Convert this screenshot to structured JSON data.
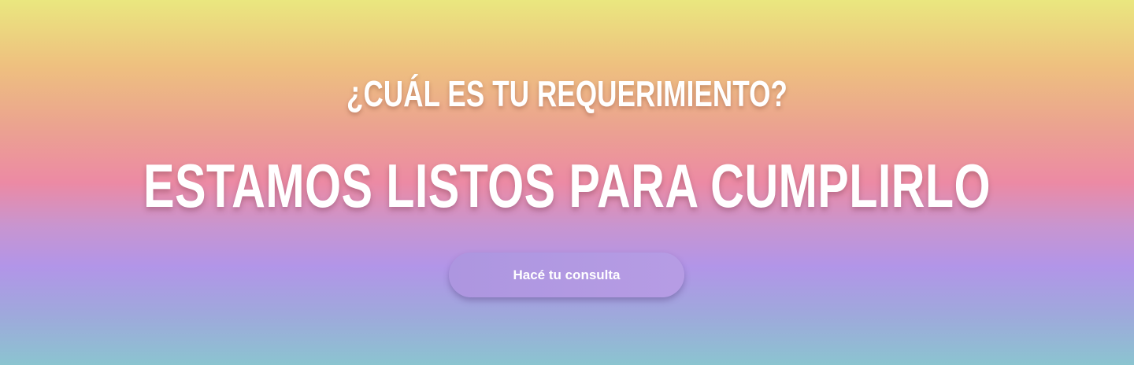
{
  "hero": {
    "kicker": "¿Cuál es tu requerimiento?",
    "headline": "Estamos listos para cumplirlo",
    "cta_label": "Hacé tu consulta"
  },
  "colors": {
    "gradient_top": "#eae77f",
    "gradient_middle": "#ec8aa4",
    "gradient_lower": "#b295e8",
    "gradient_bottom": "#8bc4d0",
    "button": "#b29ae2",
    "text": "#ffffff"
  }
}
